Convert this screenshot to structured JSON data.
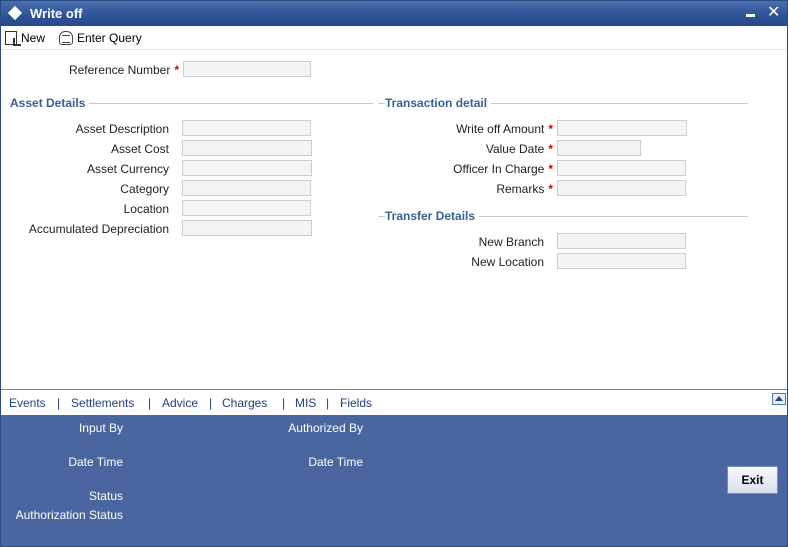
{
  "window": {
    "title": "Write off",
    "minimize_symbol": "",
    "close_symbol": "✕"
  },
  "toolbar": {
    "new_label": "New",
    "enter_query_label": "Enter Query"
  },
  "reference": {
    "label": "Reference Number",
    "value": "",
    "required": true
  },
  "asset_details": {
    "title": "Asset Details",
    "fields": [
      {
        "label": "Asset Description",
        "value": ""
      },
      {
        "label": "Asset Cost",
        "value": ""
      },
      {
        "label": "Asset Currency",
        "value": ""
      },
      {
        "label": "Category",
        "value": ""
      },
      {
        "label": "Location",
        "value": ""
      },
      {
        "label": "Accumulated Depreciation",
        "value": ""
      }
    ]
  },
  "transaction_detail": {
    "title": "Transaction detail",
    "fields": [
      {
        "label": "Write off Amount",
        "value": "",
        "required": true
      },
      {
        "label": "Value Date",
        "value": "",
        "required": true
      },
      {
        "label": "Officer In Charge",
        "value": "",
        "required": true
      },
      {
        "label": "Remarks",
        "value": "",
        "required": true
      }
    ]
  },
  "transfer_details": {
    "title": "Transfer Details",
    "fields": [
      {
        "label": "New Branch",
        "value": ""
      },
      {
        "label": "New Location",
        "value": ""
      }
    ]
  },
  "required_marker": "*",
  "bottom_tabs": {
    "items": [
      "Events",
      "Settlements",
      "Advice",
      "Charges",
      "MIS",
      "Fields"
    ],
    "separator": "|"
  },
  "audit": {
    "input_by": "Input By",
    "date_time_left": "Date Time",
    "status": "Status",
    "authorization_status": "Authorization Status",
    "authorized_by": "Authorized By",
    "date_time_right": "Date Time",
    "exit_label": "Exit"
  },
  "colors": {
    "titlebar": "#2d5295",
    "section_title": "#3a6096",
    "required": "#d40000",
    "audit_background": "#4a66a0",
    "link": "#1f3f83"
  }
}
